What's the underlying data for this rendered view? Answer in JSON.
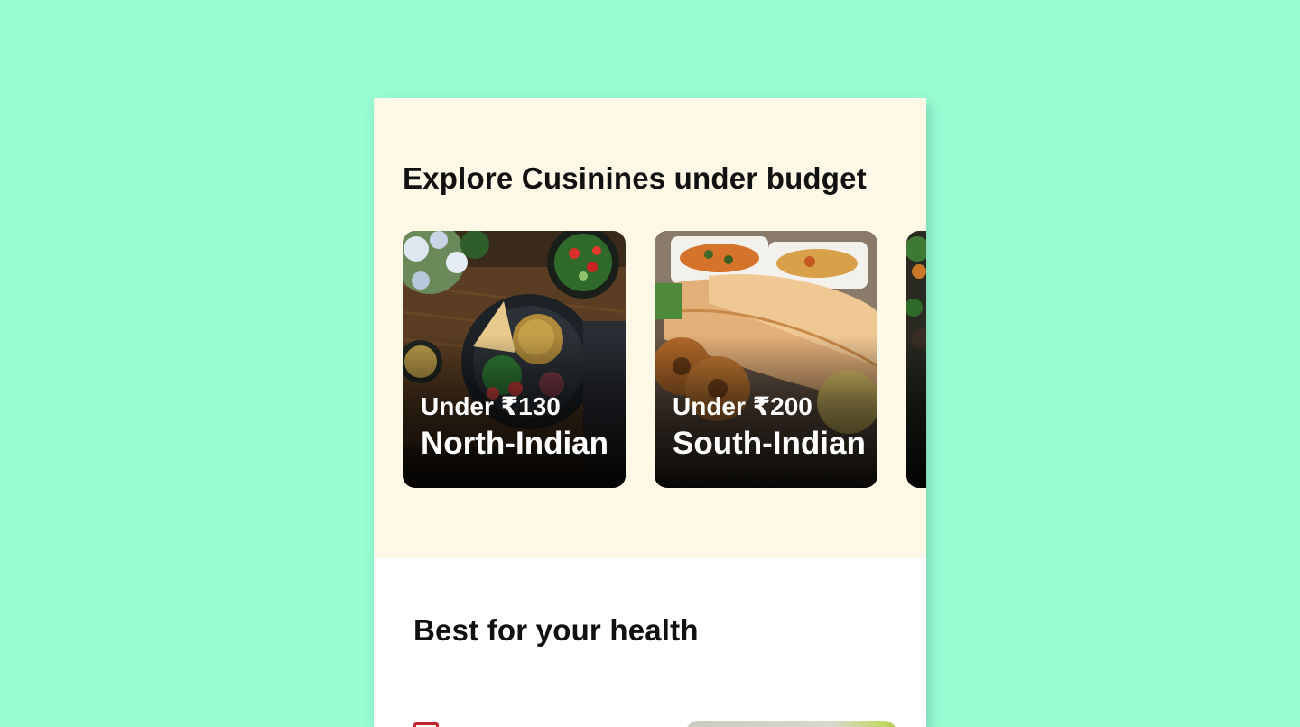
{
  "sections": {
    "budget": {
      "title": "Explore Cusinines under budget",
      "background": "#fff8e6",
      "cards": [
        {
          "price": "Under ₹130",
          "name": "North-Indian"
        },
        {
          "price": "Under ₹200",
          "name": "South-Indian"
        }
      ]
    },
    "health": {
      "title": "Best for your health"
    }
  },
  "colors": {
    "page_background": "#98fdd3",
    "card_background": "#ffffff",
    "veg_mark": "#c0262d"
  }
}
